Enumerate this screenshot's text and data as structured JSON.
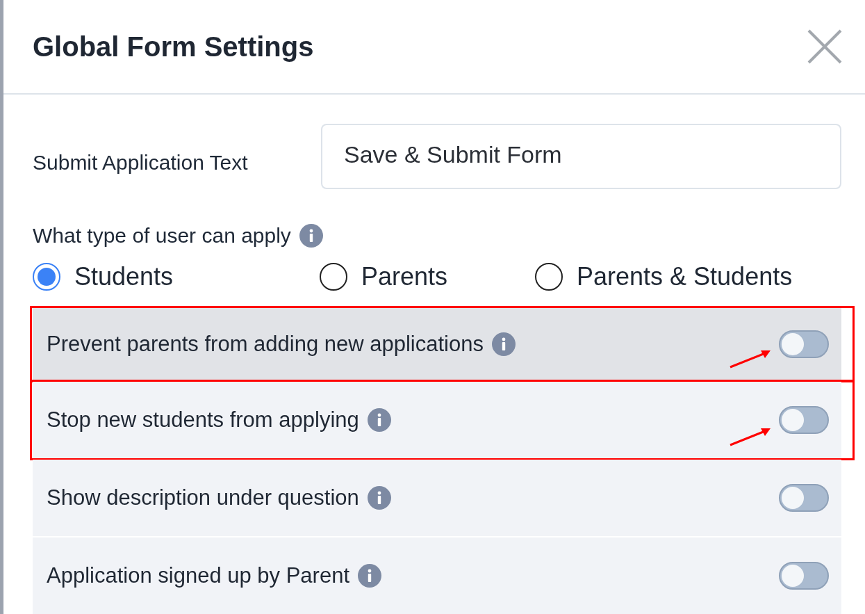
{
  "dialog": {
    "title": "Global Form Settings"
  },
  "submit_text": {
    "label": "Submit Application Text",
    "value": "Save & Submit Form"
  },
  "user_type": {
    "label": "What type of user can apply",
    "options": [
      {
        "label": "Students",
        "selected": true
      },
      {
        "label": "Parents",
        "selected": false
      },
      {
        "label": "Parents & Students",
        "selected": false
      }
    ]
  },
  "settings": [
    {
      "label": "Prevent parents from adding new applications",
      "on": false,
      "hovered": true,
      "highlighted": true
    },
    {
      "label": "Stop new students from applying",
      "on": false,
      "hovered": false,
      "highlighted": true
    },
    {
      "label": "Show description under question",
      "on": false,
      "hovered": false,
      "highlighted": false
    },
    {
      "label": "Application signed up by Parent",
      "on": false,
      "hovered": false,
      "highlighted": false
    }
  ]
}
